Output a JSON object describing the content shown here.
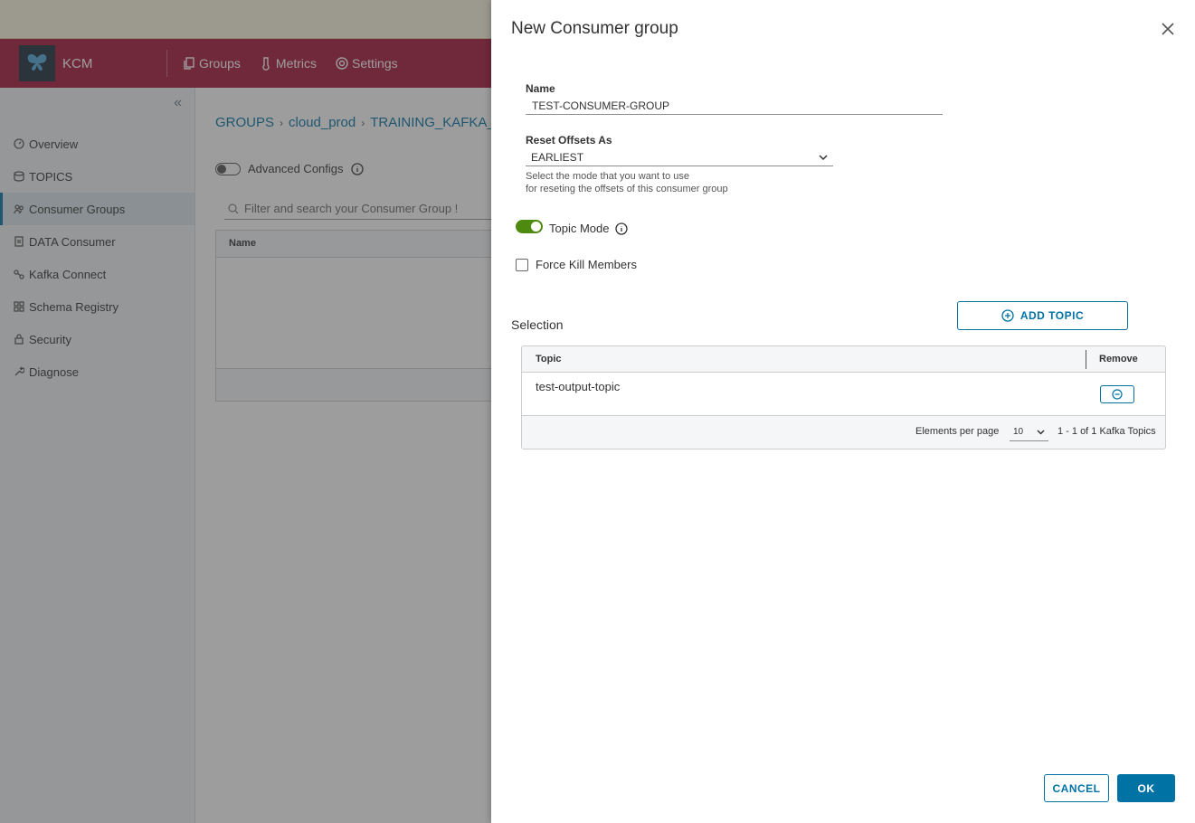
{
  "app": {
    "brand": "KCM",
    "logo_text": "KCM",
    "header_nav": [
      {
        "label": "Groups",
        "icon": "copy-icon"
      },
      {
        "label": "Metrics",
        "icon": "thermometer-icon"
      },
      {
        "label": "Settings",
        "icon": "gear-icon"
      }
    ],
    "sidebar": {
      "items": [
        {
          "label": "Overview",
          "icon": "dashboard-icon",
          "active": false
        },
        {
          "label": "TOPICS",
          "icon": "database-icon",
          "active": false
        },
        {
          "label": "Consumer Groups",
          "icon": "users-icon",
          "active": true
        },
        {
          "label": "DATA Consumer",
          "icon": "document-icon",
          "active": false
        },
        {
          "label": "Kafka Connect",
          "icon": "link-icon",
          "active": false
        },
        {
          "label": "Schema Registry",
          "icon": "grid-icon",
          "active": false
        },
        {
          "label": "Security",
          "icon": "lock-icon",
          "active": false
        },
        {
          "label": "Diagnose",
          "icon": "wrench-icon",
          "active": false
        }
      ]
    },
    "breadcrumb": [
      "GROUPS",
      "cloud_prod",
      "TRAINING_KAFKA_"
    ],
    "advanced_configs_label": "Advanced Configs",
    "filter_placeholder": "Filter and search your Consumer Group !",
    "grid_header_name": "Name"
  },
  "modal": {
    "title": "New Consumer group",
    "name_label": "Name",
    "name_value": "TEST-CONSUMER-GROUP",
    "reset_label": "Reset Offsets As",
    "reset_value": "EARLIEST",
    "reset_help_line1": "Select the mode that you want to use",
    "reset_help_line2": "for reseting the offsets of this consumer group",
    "topic_mode_label": "Topic Mode",
    "topic_mode_on": true,
    "force_kill_label": "Force Kill Members",
    "force_kill_checked": false,
    "selection_label": "Selection",
    "add_topic_label": "ADD TOPIC",
    "table": {
      "col_topic": "Topic",
      "col_remove": "Remove",
      "rows": [
        {
          "topic": "test-output-topic"
        }
      ],
      "per_page_label": "Elements per page",
      "per_page_value": "10",
      "range": "1 - 1 of 1 Kafka Topics"
    },
    "cancel_label": "CANCEL",
    "ok_label": "OK"
  },
  "colors": {
    "header": "#a5153a",
    "accent": "#0072a3",
    "toggle_on": "#4f8a10"
  }
}
